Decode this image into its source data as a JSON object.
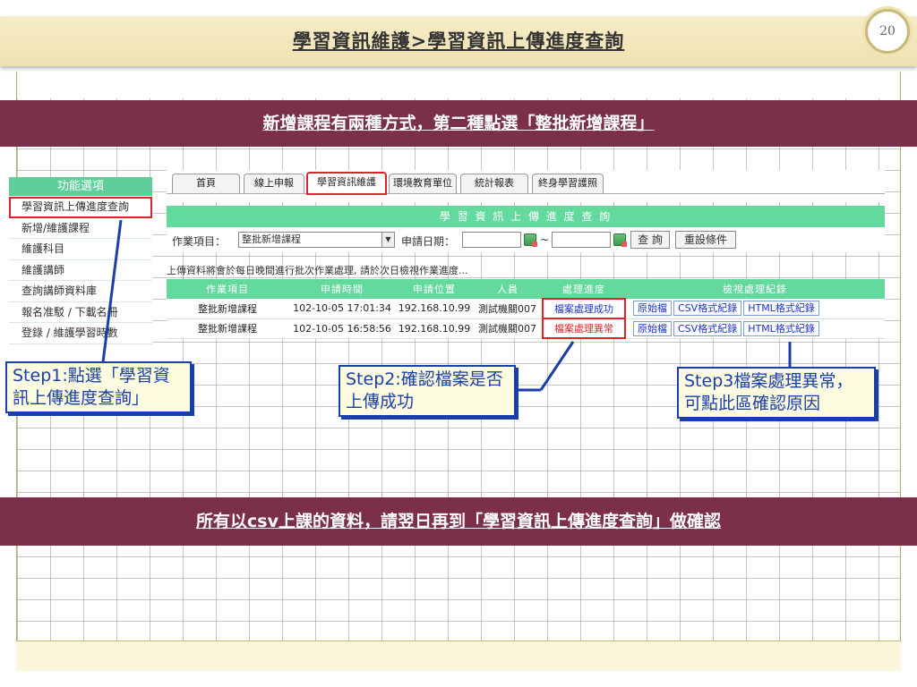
{
  "header": {
    "title": "學習資訊維護>學習資訊上傳進度查詢",
    "page_number": "20"
  },
  "banners": {
    "top": "新增課程有兩種方式，第二種點選「整批新增課程」",
    "bottom": "所有以csv上課的資料，請翌日再到「學習資訊上傳進度查詢」做確認"
  },
  "sidebar": {
    "header": "功能選項",
    "items": [
      {
        "label": "學習資訊上傳進度查詢",
        "active": true
      },
      {
        "label": "新增/維護課程"
      },
      {
        "label": "維護科目"
      },
      {
        "label": "維護講師"
      },
      {
        "label": "查詢講師資料庫"
      },
      {
        "label": "報名准駁 / 下載名冊"
      },
      {
        "label": "登錄 / 維護學習時數"
      }
    ]
  },
  "tabs": [
    {
      "label": "首頁"
    },
    {
      "label": "線上申報"
    },
    {
      "label": "學習資訊維護",
      "active": true
    },
    {
      "label": "環境教育單位"
    },
    {
      "label": "統計報表"
    },
    {
      "label": "終身學習護照"
    }
  ],
  "panel": {
    "title": "學 習 資 訊 上 傳 進 度 查 詢",
    "job_label": "作業項目：",
    "job_value": "整批新增課程",
    "date_label": "申請日期：",
    "date_sep": "~",
    "query_button": "查 詢",
    "reset_button": "重設條件",
    "notice": "上傳資料將會於每日晚間進行批次作業處理, 請於次日檢視作業進度..."
  },
  "table": {
    "headers": [
      "作業項目",
      "申請時間",
      "申請位置",
      "人員",
      "處理進度",
      "檢視處理紀錄"
    ],
    "rows": [
      {
        "job": "整批新增課程",
        "time": "102-10-05 17:01:34",
        "ip": "192.168.10.99",
        "user": "測試機關007",
        "status": "檔案處理成功",
        "status_type": "ok"
      },
      {
        "job": "整批新增課程",
        "time": "102-10-05 16:58:56",
        "ip": "192.168.10.99",
        "user": "測試機關007",
        "status": "檔案處理異常",
        "status_type": "error"
      }
    ],
    "log_buttons": [
      "原始檔",
      "CSV格式紀錄",
      "HTML格式紀錄"
    ]
  },
  "callouts": {
    "step1": "Step1:點選「學習資訊上傳進度查詢」",
    "step2": "Step2:確認檔案是否上傳成功",
    "step3": "Step3檔案處理異常，可點此區確認原因"
  },
  "colors": {
    "maroon": "#7b2f4a",
    "green": "#63d99d",
    "red": "#e0222b",
    "callout_blue": "#1b3fa8"
  }
}
